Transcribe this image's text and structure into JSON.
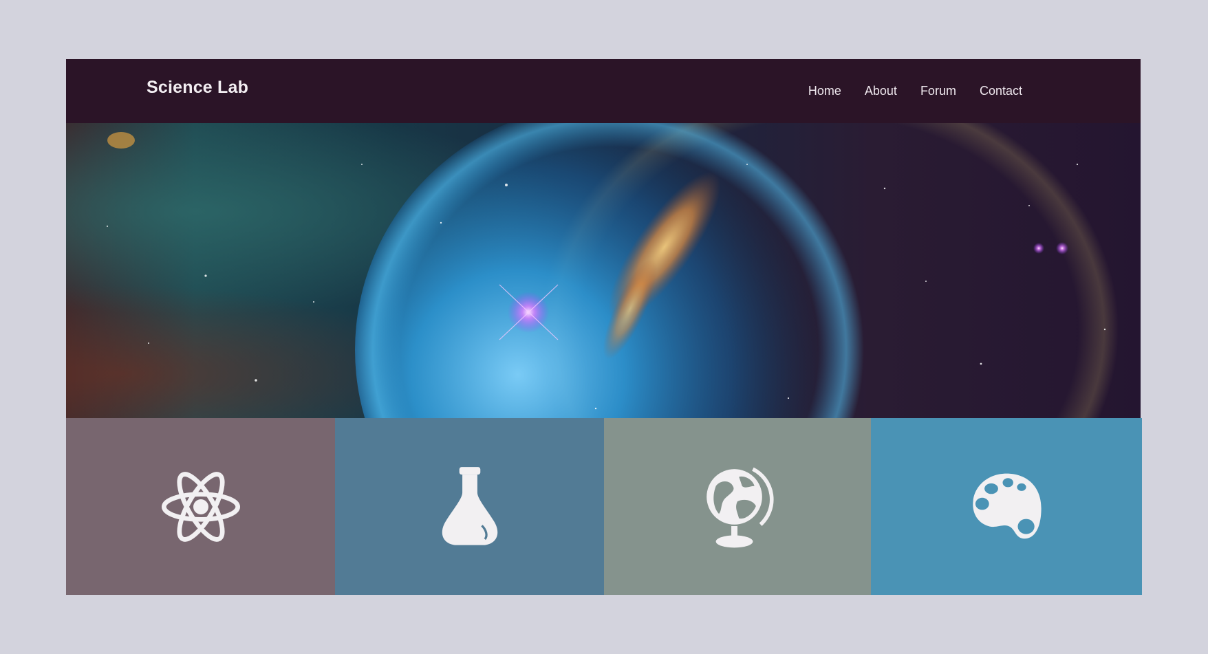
{
  "brand": {
    "name": "Science Lab"
  },
  "nav": {
    "items": [
      {
        "label": "Home"
      },
      {
        "label": "About"
      },
      {
        "label": "Forum"
      },
      {
        "label": "Contact"
      }
    ]
  },
  "hero": {
    "image": "bubble-nebula-space-photo"
  },
  "tiles": [
    {
      "icon": "atom-icon",
      "color": "#78666f"
    },
    {
      "icon": "flask-icon",
      "color": "#527b95"
    },
    {
      "icon": "globe-icon",
      "color": "#85938d"
    },
    {
      "icon": "palette-icon",
      "color": "#4a93b5"
    }
  ],
  "colors": {
    "page_background": "#d3d3dd",
    "navbar_background": "#2b1427",
    "nav_text": "#efe8ee",
    "icon_fill": "#f2f0f2"
  }
}
